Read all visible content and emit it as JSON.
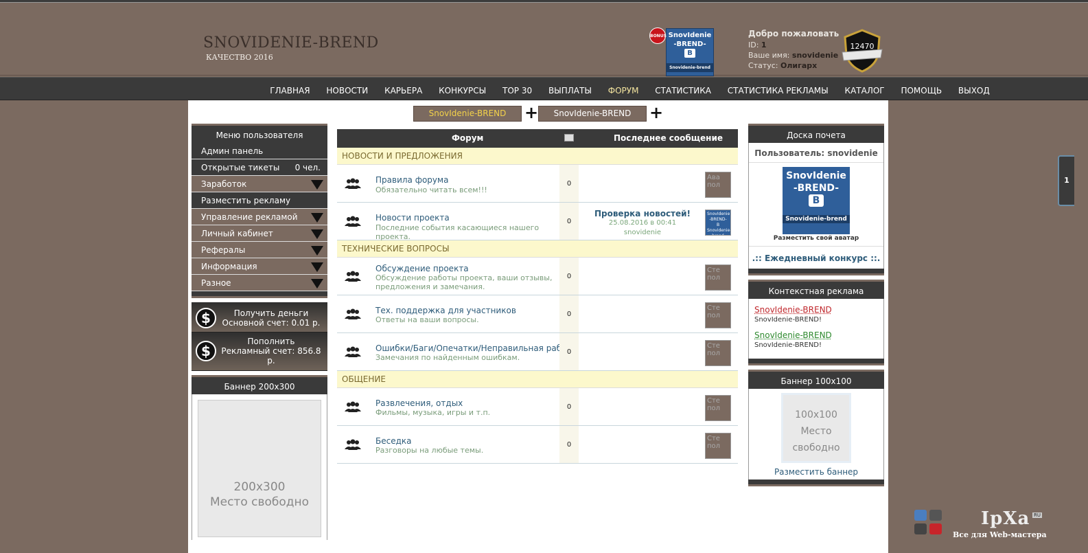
{
  "site": {
    "title": "SNOVIDENIE-BREND",
    "subtitle": "КАЧЕСТВО 2016"
  },
  "header": {
    "bonus": "BONUS",
    "logo_lines": [
      "SnovIdenie",
      "-BREND-",
      "B",
      "Snovidenie-brend"
    ],
    "welcome_title": "Добро пожаловать",
    "id_label": "ID:",
    "id_value": "1",
    "name_label": "Ваше имя:",
    "name_value": "snovidenie",
    "status_label": "Статус:",
    "status_value": "Олигарх",
    "score": "12470"
  },
  "nav": [
    "ГЛАВНАЯ",
    "НОВОСТИ",
    "КАРЬЕРА",
    "КОНКУРСЫ",
    "TOP 30",
    "ВЫПЛАТЫ",
    "ФОРУМ",
    "СТАТИСТИКА",
    "СТАТИСТИКА РЕКЛАМЫ",
    "КАТАЛОГ",
    "ПОМОЩЬ",
    "ВЫХОД"
  ],
  "nav_active": "ФОРУМ",
  "switch": {
    "btn1": "SnovIdenie-BREND",
    "btn2": "SnovIdenie-BREND",
    "plus": "+"
  },
  "left": {
    "menu_title": "Меню пользователя",
    "items": [
      {
        "label": "Админ панель"
      },
      {
        "label": "Открытые тикеты",
        "count": "0 чел."
      },
      {
        "label": "Заработок"
      },
      {
        "label": "Разместить рекламу"
      },
      {
        "label": "Управление рекламой"
      },
      {
        "label": "Личный кабинет"
      },
      {
        "label": "Рефералы"
      },
      {
        "label": "Информация"
      },
      {
        "label": "Разное"
      }
    ],
    "money1_title": "Получить деньги",
    "money1_value": "Основной счет: 0.01 р.",
    "money2_title": "Пополнить",
    "money2_value": "Рекламный счет: 856.8 р.",
    "banner_title": "Баннер 200x300",
    "banner_size": "200x300",
    "banner_free": "Место свободно"
  },
  "forum": {
    "col_forum": "Форум",
    "col_last": "Последнее сообщение",
    "categories": [
      {
        "name": "НОВОСТИ И ПРЕДЛОЖЕНИЯ",
        "rows": [
          {
            "title": "Правила форума",
            "desc": "Обязательно читать всем!!!",
            "count": "0",
            "avatar_alt": "Ава пол"
          },
          {
            "title": "Новости проекта",
            "desc": "Последние события касающиеся нашего проекта.",
            "count": "0",
            "last_title": "Проверка новостей!",
            "last_date": "25.08.2016 в 00:41",
            "last_user": "snovidenie"
          }
        ]
      },
      {
        "name": "ТЕХНИЧЕСКИЕ ВОПРОСЫ",
        "rows": [
          {
            "title": "Обсуждение проекта",
            "desc": "Обсуждение работы проекта, ваши отзывы, предложения и замечания.",
            "count": "0",
            "avatar_alt": "Сте пол"
          },
          {
            "title": "Тех. поддержка для участников",
            "desc": "Ответы на ваши вопросы.",
            "count": "0",
            "avatar_alt": "Сте пол"
          },
          {
            "title": "Ошибки/Баги/Опечатки/Неправильная работа",
            "desc": "Замечания по найденным ошибкам.",
            "count": "0",
            "avatar_alt": "Сте пол"
          }
        ]
      },
      {
        "name": "ОБЩЕНИЕ",
        "rows": [
          {
            "title": "Развлечения, отдых",
            "desc": "Фильмы, музыка, игры и т.п.",
            "count": "0",
            "avatar_alt": "Сте пол"
          },
          {
            "title": "Беседка",
            "desc": "Разговоры на любые темы.",
            "count": "0",
            "avatar_alt": "Сте пол"
          }
        ]
      }
    ]
  },
  "right": {
    "honor_title": "Доска почета",
    "honor_user_label": "Пользователь:",
    "honor_user": "snovidenie",
    "honor_ava_lines": [
      "SnovIdenie",
      "-BREND-",
      "B",
      "Snovidenie-brend"
    ],
    "honor_link": "Разместить свой аватар",
    "daily": ".:: Ежедневный конкурс ::.",
    "ctx_title": "Контекстная реклама",
    "ads": [
      {
        "title": "SnovIdenie-BREND",
        "desc": "SnovIdenie-BREND!",
        "color": "#c0282d"
      },
      {
        "title": "SnovIdenie-BREND",
        "desc": "SnovIdenie-BREND!",
        "color": "#2f8a2f"
      }
    ],
    "b100_title": "Баннер 100x100",
    "b100_lines": [
      "100x100",
      "Место",
      "свободно"
    ],
    "b100_link": "Разместить баннер"
  },
  "side_tab": "1",
  "watermark": {
    "name": "IpXa",
    "ru": "RU",
    "tag": "Все для Web-мастера"
  },
  "colors": {
    "brown": "#7b6a60",
    "dark": "#3a3a3a",
    "category_bg": "#fcf8cc",
    "link": "#2e5c7a"
  }
}
